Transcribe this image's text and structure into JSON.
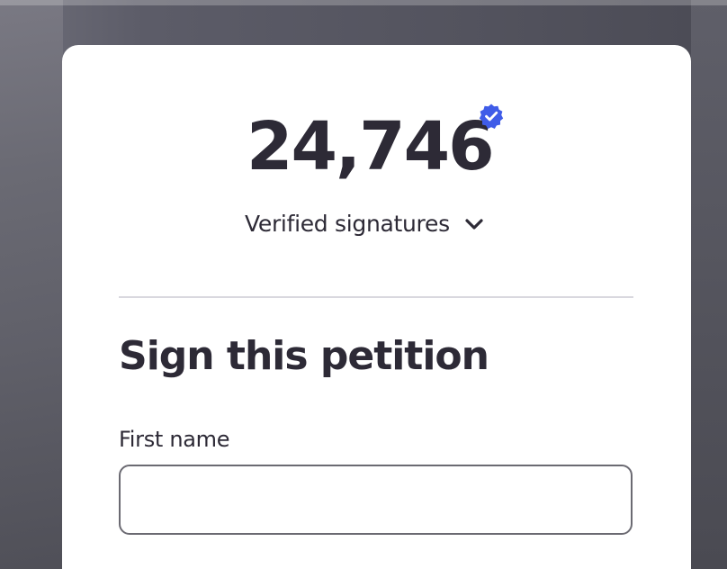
{
  "petition": {
    "signature_count": "24,746",
    "verified_label": "Verified signatures",
    "verified_icon": "verified-badge-icon",
    "toggle_icon": "chevron-down-icon",
    "accent_color": "#3f5ce8"
  },
  "form": {
    "title": "Sign this petition",
    "first_name_label": "First name",
    "first_name_value": "",
    "first_name_placeholder": ""
  }
}
